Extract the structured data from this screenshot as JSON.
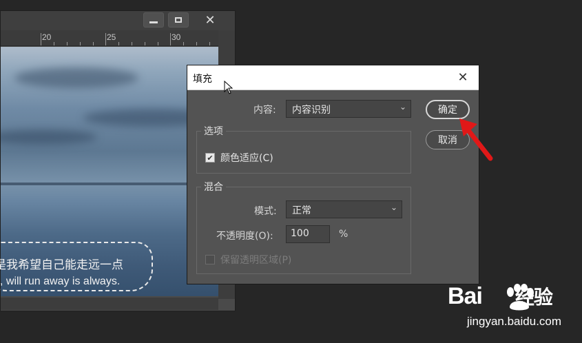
{
  "document": {
    "ruler": {
      "labels": [
        "20",
        "25",
        "30"
      ]
    },
    "overlay": {
      "line_zh": "是我希望自己能走远一点",
      "line_en": ", will run away is always."
    }
  },
  "dialog": {
    "title": "填充",
    "content_label": "内容:",
    "content_value": "内容识别",
    "ok_label": "确定",
    "cancel_label": "取消",
    "options": {
      "title": "选项",
      "color_adapt_label": "颜色适应(C)",
      "color_adapt_checked": true
    },
    "blend": {
      "title": "混合",
      "mode_label": "模式:",
      "mode_value": "正常",
      "opacity_label": "不透明度(O):",
      "opacity_value": "100",
      "opacity_unit": "%",
      "preserve_label": "保留透明区域(P)",
      "preserve_checked": false
    }
  },
  "watermark": {
    "logo_left": "Bai",
    "logo_right": "经验",
    "url": "jingyan.baidu.com"
  },
  "colors": {
    "arrow": "#e01818",
    "dialog_bg": "#535353",
    "app_bg": "#262626"
  }
}
